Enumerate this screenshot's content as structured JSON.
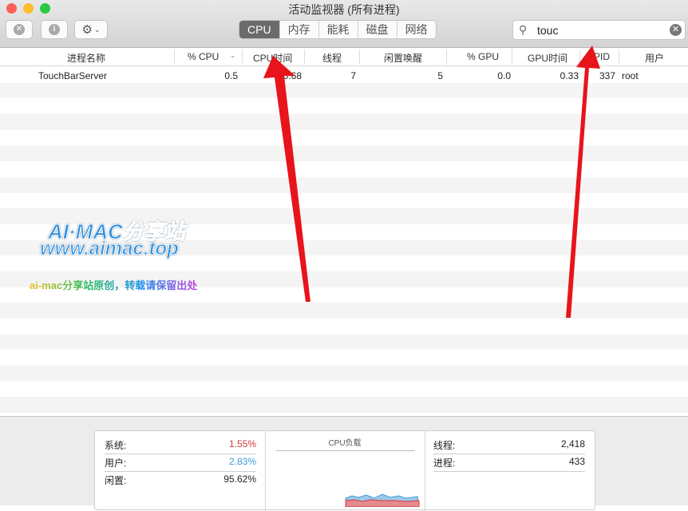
{
  "window": {
    "title": "活动监视器 (所有进程)"
  },
  "toolbar": {
    "tabs": [
      "CPU",
      "内存",
      "能耗",
      "磁盘",
      "网络"
    ],
    "active_tab": "CPU",
    "search_value": "touc"
  },
  "table": {
    "columns": [
      "进程名称",
      "% CPU",
      "CPU时间",
      "线程",
      "闲置唤醒",
      "% GPU",
      "GPU时间",
      "PID",
      "用户"
    ],
    "rows": [
      {
        "name": "TouchBarServer",
        "cpu": "0.5",
        "cpu_time": "0.68",
        "threads": "7",
        "idle_wakeups": "5",
        "gpu": "0.0",
        "gpu_time": "0.33",
        "pid": "337",
        "user": "root"
      }
    ]
  },
  "summary": {
    "system_label": "系统:",
    "system_value": "1.55%",
    "user_label": "用户:",
    "user_value": "2.83%",
    "idle_label": "闲置:",
    "idle_value": "95.62%",
    "chart_title": "CPU负载",
    "threads_label": "线程:",
    "threads_value": "2,418",
    "processes_label": "进程:",
    "processes_value": "433"
  },
  "colors": {
    "system": "#d0393f",
    "user": "#3a9bd6",
    "arrow": "#e8141b"
  },
  "watermark": {
    "line1": "AI·MAC分享站",
    "line2": "www.aimac.top",
    "line3": "ai-mac分享站原创，转载请保留出处"
  }
}
